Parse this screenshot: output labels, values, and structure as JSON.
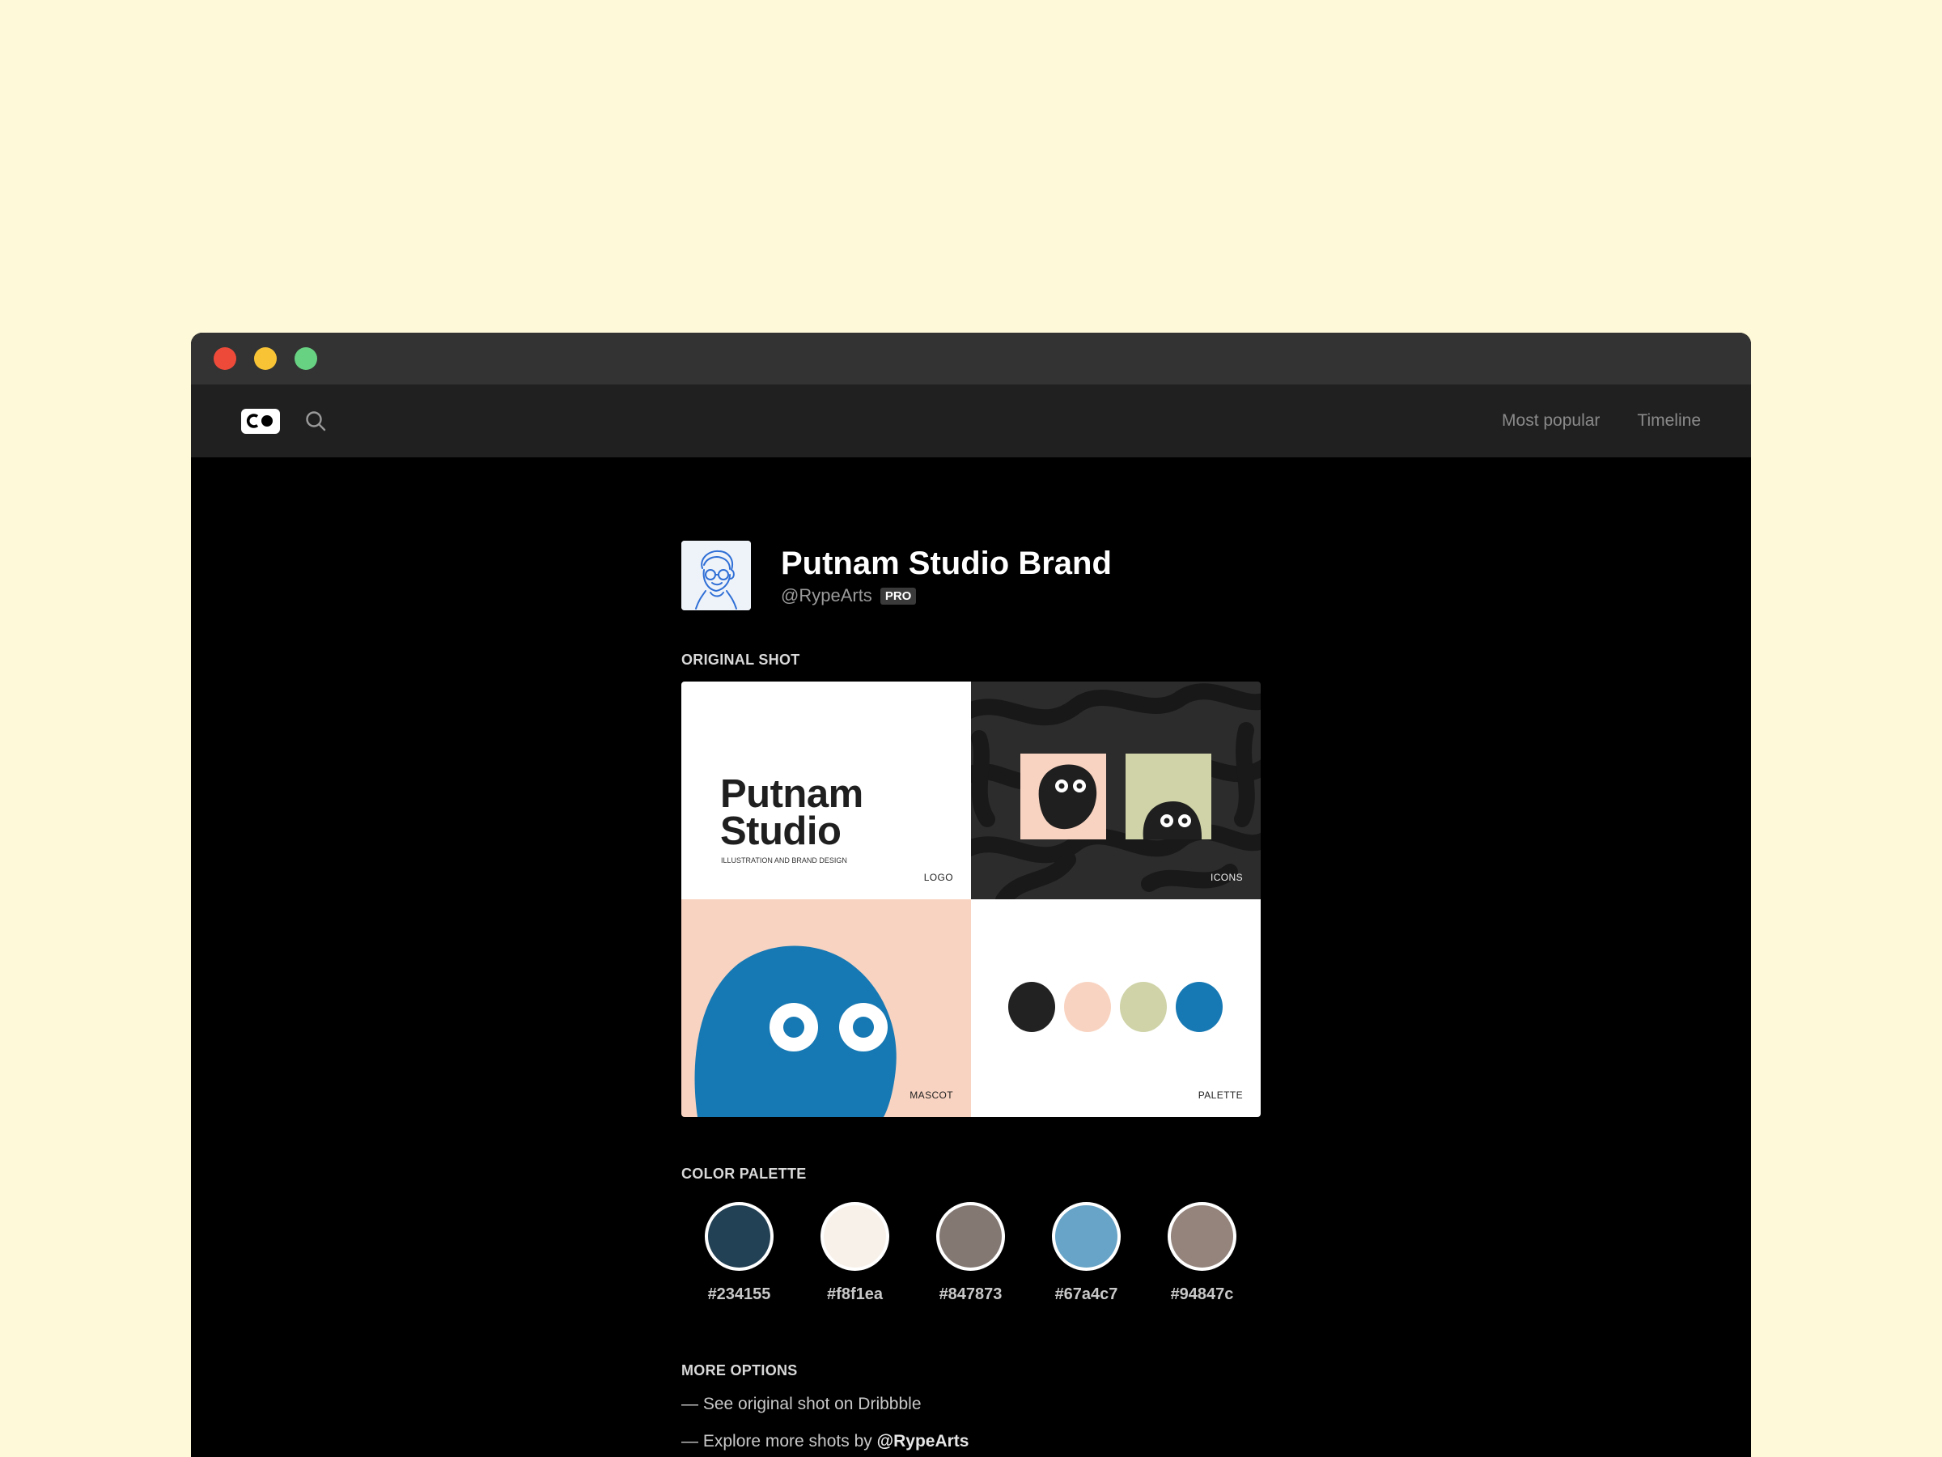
{
  "window": {
    "traffic_lights": [
      "#ee4a3a",
      "#f8c436",
      "#68d283"
    ]
  },
  "nav": {
    "logo_icon": "co-logo-icon",
    "search_icon": "search-icon",
    "links": [
      "Most popular",
      "Timeline"
    ]
  },
  "shot": {
    "title": "Putnam Studio Brand",
    "username": "@RypeArts",
    "badge": "PRO"
  },
  "original_shot": {
    "label": "ORIGINAL SHOT",
    "panels": {
      "logo": {
        "word1": "Putnam",
        "word2": "Studio",
        "tagline": "ILLUSTRATION AND BRAND DESIGN",
        "label": "LOGO"
      },
      "icons": {
        "label": "ICONS"
      },
      "mascot": {
        "label": "MASCOT"
      },
      "palette": {
        "label": "PALETTE",
        "dots": [
          "#222222",
          "#f9d3c1",
          "#cfd3a7",
          "#1779b4"
        ]
      }
    }
  },
  "color_palette": {
    "label": "COLOR PALETTE",
    "colors": [
      {
        "hex": "#234155"
      },
      {
        "hex": "#f8f1ea"
      },
      {
        "hex": "#847873"
      },
      {
        "hex": "#67a4c7"
      },
      {
        "hex": "#94847c"
      }
    ]
  },
  "more_options": {
    "label": "MORE OPTIONS",
    "dash": "—",
    "item1": "See original shot on Dribbble",
    "item2_prefix": "Explore more shots by",
    "item2_user": "@RypeArts"
  }
}
